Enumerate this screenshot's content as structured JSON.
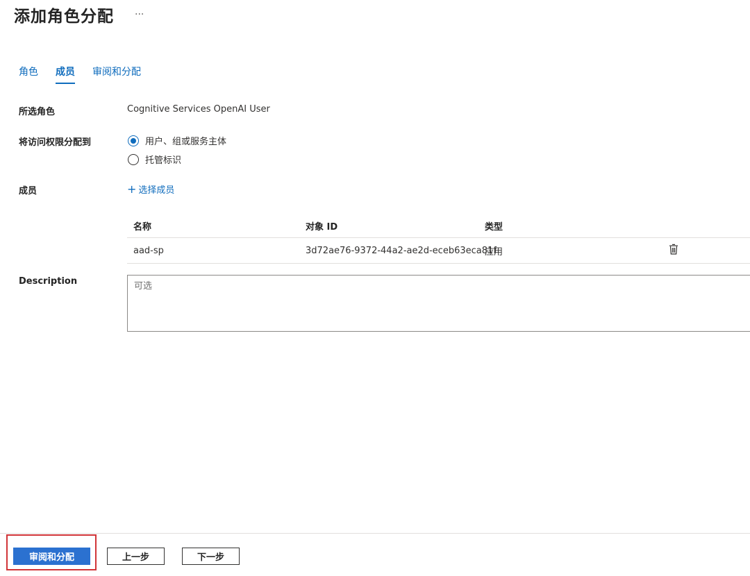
{
  "header": {
    "title": "添加角色分配",
    "more_label": "···"
  },
  "tabs": [
    {
      "label": "角色",
      "active": false
    },
    {
      "label": "成员",
      "active": true
    },
    {
      "label": "审阅和分配",
      "active": false
    }
  ],
  "form": {
    "selected_role_label": "所选角色",
    "selected_role_value": "Cognitive Services OpenAI User",
    "assign_access_label": "将访问权限分配到",
    "assign_options": [
      {
        "label": "用户、组或服务主体",
        "checked": true
      },
      {
        "label": "托管标识",
        "checked": false
      }
    ],
    "members_label": "成员",
    "select_members_label": "选择成员",
    "description_label": "Description",
    "description_placeholder": "可选",
    "description_value": ""
  },
  "members_table": {
    "columns": [
      "名称",
      "对象 ID",
      "类型"
    ],
    "rows": [
      {
        "name": "aad-sp",
        "object_id": "3d72ae76-9372-44a2-ae2d-eceb63eca81f",
        "type": "应用"
      }
    ]
  },
  "footer": {
    "review_assign_label": "审阅和分配",
    "previous_label": "上一步",
    "next_label": "下一步"
  },
  "colors": {
    "accent": "#0f6cbd",
    "primary_button": "#2b71d0",
    "highlight": "#d13438"
  },
  "icons": {
    "plus": "plus-icon",
    "delete": "trash-icon",
    "more": "more-icon"
  }
}
